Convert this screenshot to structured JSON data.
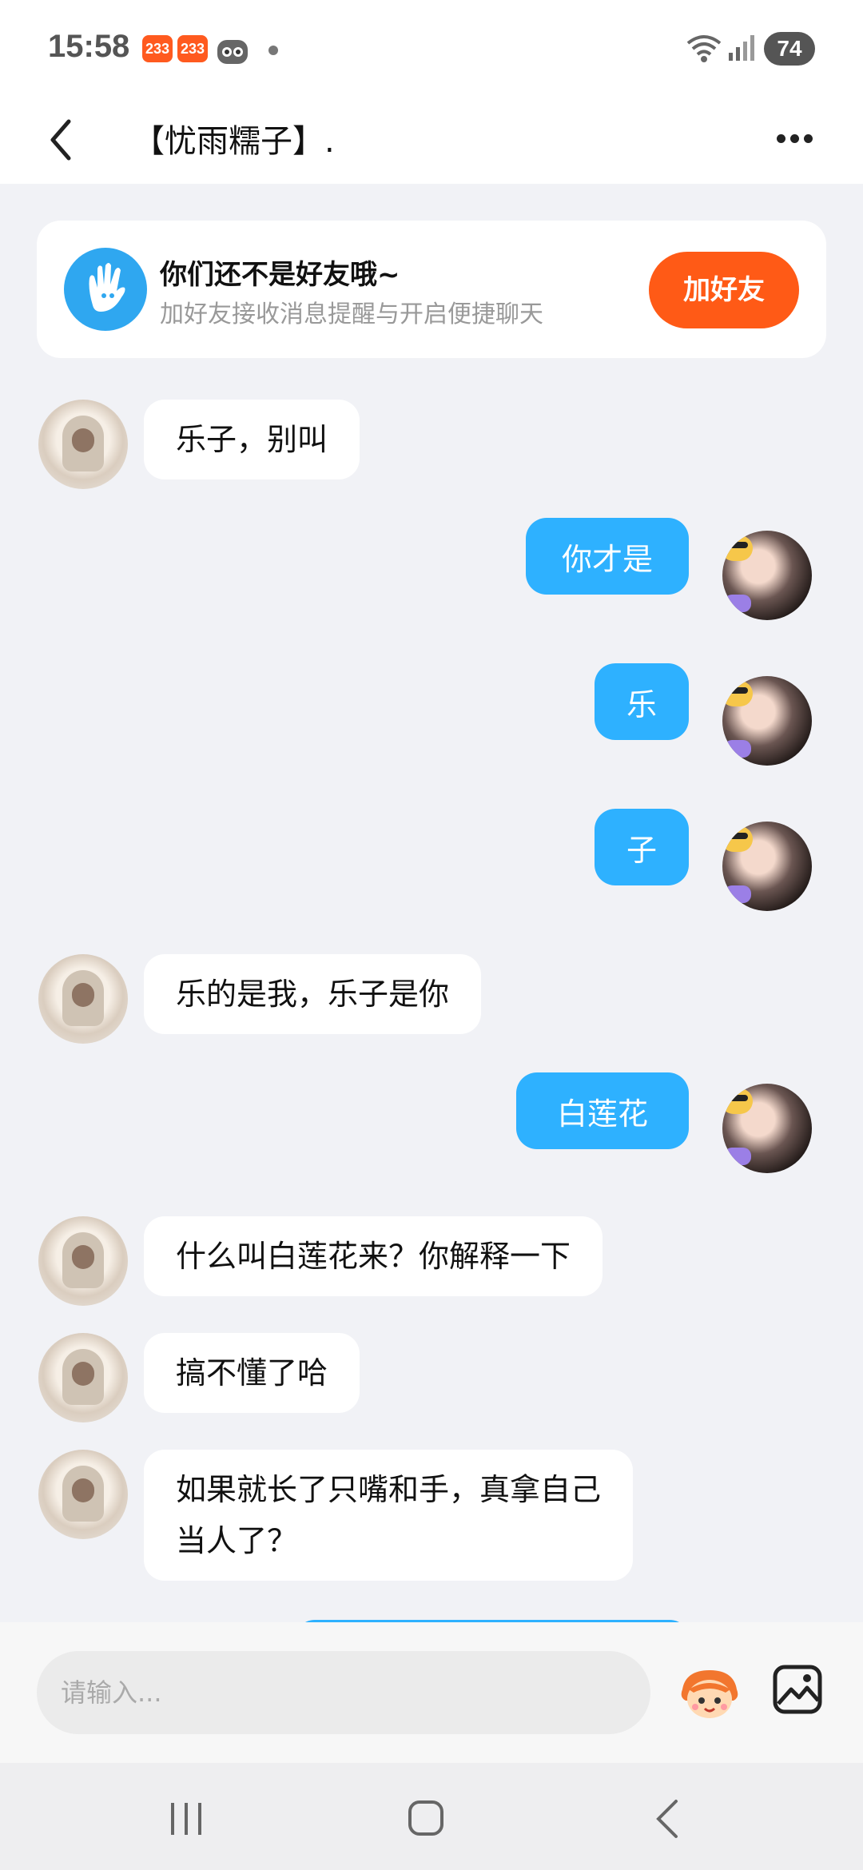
{
  "status_bar": {
    "time": "15:58",
    "badge1": "233",
    "badge2": "233",
    "battery": "74",
    "icons": [
      "robot-icon",
      "dot-icon",
      "wifi-icon",
      "signal-icon"
    ]
  },
  "header": {
    "title": "【忧雨糯子】.",
    "back_icon": "chevron-left-icon",
    "more_icon": "more-dots-icon"
  },
  "friend_banner": {
    "title": "你们还不是好友哦~",
    "subtitle": "加好友接收消息提醒与开启便捷聊天",
    "button_label": "加好友",
    "icon": "wave-hand-icon"
  },
  "messages": [
    {
      "from": "other",
      "text": "乐子，别叫"
    },
    {
      "from": "self",
      "text": "你才是"
    },
    {
      "from": "self",
      "text": "乐"
    },
    {
      "from": "self",
      "text": "子"
    },
    {
      "from": "other",
      "text": "乐的是我，乐子是你"
    },
    {
      "from": "self",
      "text": "白莲花"
    },
    {
      "from": "other",
      "text": "什么叫白莲花来？你解释一下"
    },
    {
      "from": "other",
      "text": "搞不懂了哈"
    },
    {
      "from": "other",
      "text": "如果就长了只嘴和手，真拿自己当人了？",
      "lines": [
        "如果就长了只嘴和手，真拿自己",
        "当人了？"
      ]
    }
  ],
  "input": {
    "placeholder": "请输入...",
    "value": "",
    "emoji_icon": "mascot-emoji-icon",
    "image_icon": "image-icon"
  },
  "nav_bar": {
    "icons": [
      "recents-icon",
      "home-icon",
      "back-icon"
    ]
  },
  "colors": {
    "self_bubble": "#2eb1ff",
    "accent_button": "#ff5a16",
    "background": "#f1f2f6"
  }
}
